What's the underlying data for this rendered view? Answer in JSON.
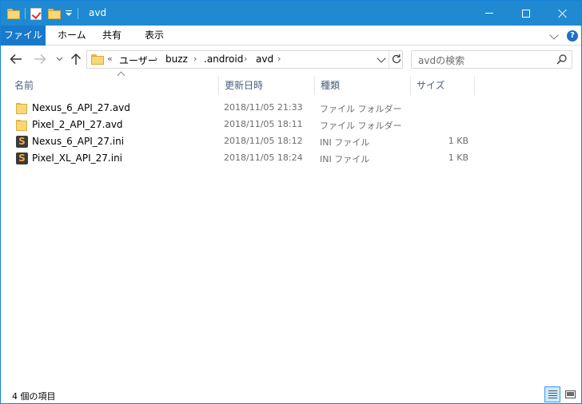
{
  "window": {
    "title": "avd",
    "accent_color": "#1f8ad2"
  },
  "ribbon": {
    "tabs": [
      {
        "label": "ファイル"
      },
      {
        "label": "ホーム"
      },
      {
        "label": "共有"
      },
      {
        "label": "表示"
      }
    ]
  },
  "address": {
    "overflow": "«",
    "crumbs": [
      "ユーザー",
      "buzz",
      ".android",
      "avd"
    ],
    "separator": "›"
  },
  "search": {
    "placeholder": "avdの検索"
  },
  "columns": {
    "name": "名前",
    "date": "更新日時",
    "type": "種類",
    "size": "サイズ"
  },
  "files": [
    {
      "name": "Nexus_6_API_27.avd",
      "date": "2018/11/05 21:33",
      "type": "ファイル フォルダー",
      "size": "",
      "icon": "folder-icon"
    },
    {
      "name": "Pixel_2_API_27.avd",
      "date": "2018/11/05 18:11",
      "type": "ファイル フォルダー",
      "size": "",
      "icon": "folder-icon"
    },
    {
      "name": "Nexus_6_API_27.ini",
      "date": "2018/11/05 18:12",
      "type": "INI ファイル",
      "size": "1 KB",
      "icon": "sublime-file-icon"
    },
    {
      "name": "Pixel_XL_API_27.ini",
      "date": "2018/11/05 18:24",
      "type": "INI ファイル",
      "size": "1 KB",
      "icon": "sublime-file-icon"
    }
  ],
  "status": {
    "item_count": "4 個の項目"
  }
}
